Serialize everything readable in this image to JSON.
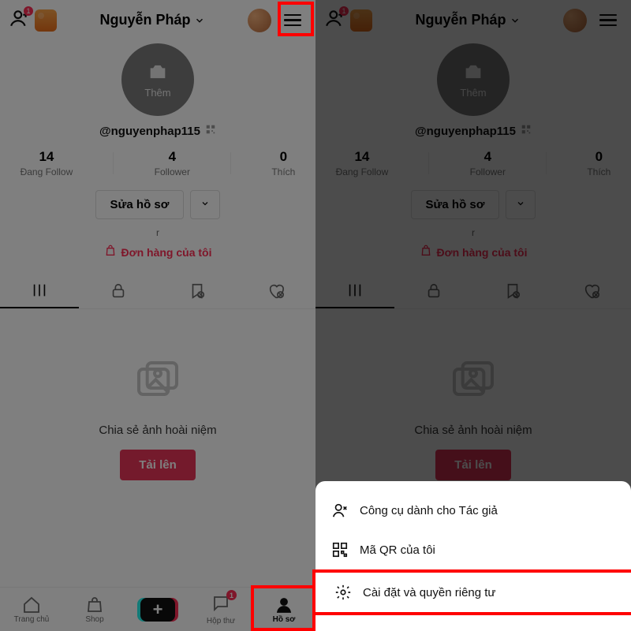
{
  "header": {
    "title": "Nguyễn Pháp",
    "add_friend_badge": "1"
  },
  "profile": {
    "avatar_add_label": "Thêm",
    "handle": "@nguyenphap115"
  },
  "stats": {
    "following": {
      "value": "14",
      "label": "Đang Follow"
    },
    "followers": {
      "value": "4",
      "label": "Follower"
    },
    "likes": {
      "value": "0",
      "label": "Thích"
    }
  },
  "edit_profile_label": "Sửa hồ sơ",
  "r_text": "r",
  "orders_label": "Đơn hàng của tôi",
  "empty": {
    "text": "Chia sẻ ảnh hoài niệm",
    "upload_label": "Tải lên"
  },
  "nav": {
    "home": "Trang chủ",
    "shop": "Shop",
    "inbox": "Hộp thư",
    "inbox_badge": "1",
    "profile": "Hồ sơ"
  },
  "sheet": {
    "creator_tools": "Công cụ dành cho Tác giả",
    "my_qr": "Mã QR của tôi",
    "settings_privacy": "Cài đặt và quyền riêng tư"
  }
}
